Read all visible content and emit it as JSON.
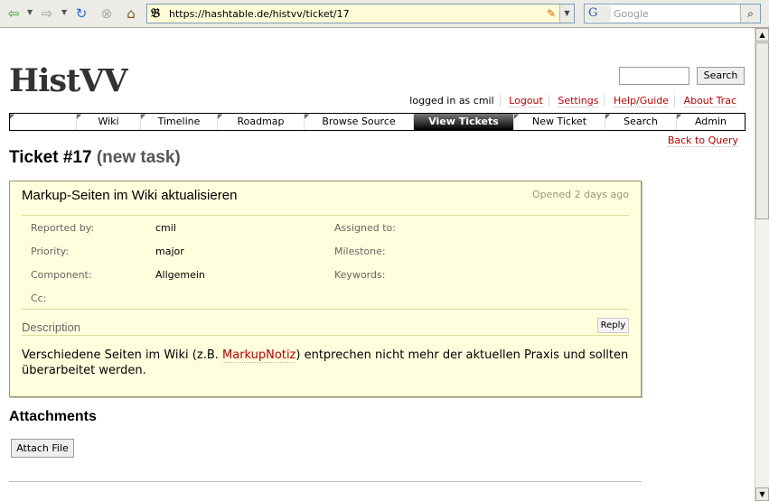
{
  "browser": {
    "url": "https://hashtable.de/histvv/ticket/17",
    "search_placeholder": "Google",
    "search_engine_glyph": "G"
  },
  "site": {
    "logo": "HistVV",
    "search_button": "Search"
  },
  "metanav": {
    "logged_in": "logged in as cmil",
    "logout": "Logout",
    "settings": "Settings",
    "help": "Help/Guide",
    "about": "About Trac"
  },
  "mainnav": {
    "items": [
      {
        "label": ""
      },
      {
        "label": "Wiki"
      },
      {
        "label": "Timeline"
      },
      {
        "label": "Roadmap"
      },
      {
        "label": "Browse Source"
      },
      {
        "label": "View Tickets"
      },
      {
        "label": "New Ticket"
      },
      {
        "label": "Search"
      },
      {
        "label": "Admin"
      }
    ],
    "active_index": 5
  },
  "ctxnav": {
    "back": "Back to Query"
  },
  "ticket": {
    "number": "Ticket #17",
    "type": "(new task)",
    "summary": "Markup-Seiten im Wiki aktualisieren",
    "opened": "Opened 2 days ago",
    "props": {
      "reported_by_label": "Reported by:",
      "reported_by": "cmil",
      "assigned_to_label": "Assigned to:",
      "assigned_to": "",
      "priority_label": "Priority:",
      "priority": "major",
      "milestone_label": "Milestone:",
      "milestone": "",
      "component_label": "Component:",
      "component": "Allgemein",
      "keywords_label": "Keywords:",
      "keywords": "",
      "cc_label": "Cc:",
      "cc": ""
    },
    "description_label": "Description",
    "reply": "Reply",
    "description": {
      "before": "Verschiedene Seiten im Wiki (z.B. ",
      "link": "MarkupNotiz",
      "after": ") entprechen nicht mehr der aktuellen Praxis und sollten überarbeitet werden."
    }
  },
  "attachments": {
    "heading": "Attachments",
    "attach_button": "Attach File"
  }
}
